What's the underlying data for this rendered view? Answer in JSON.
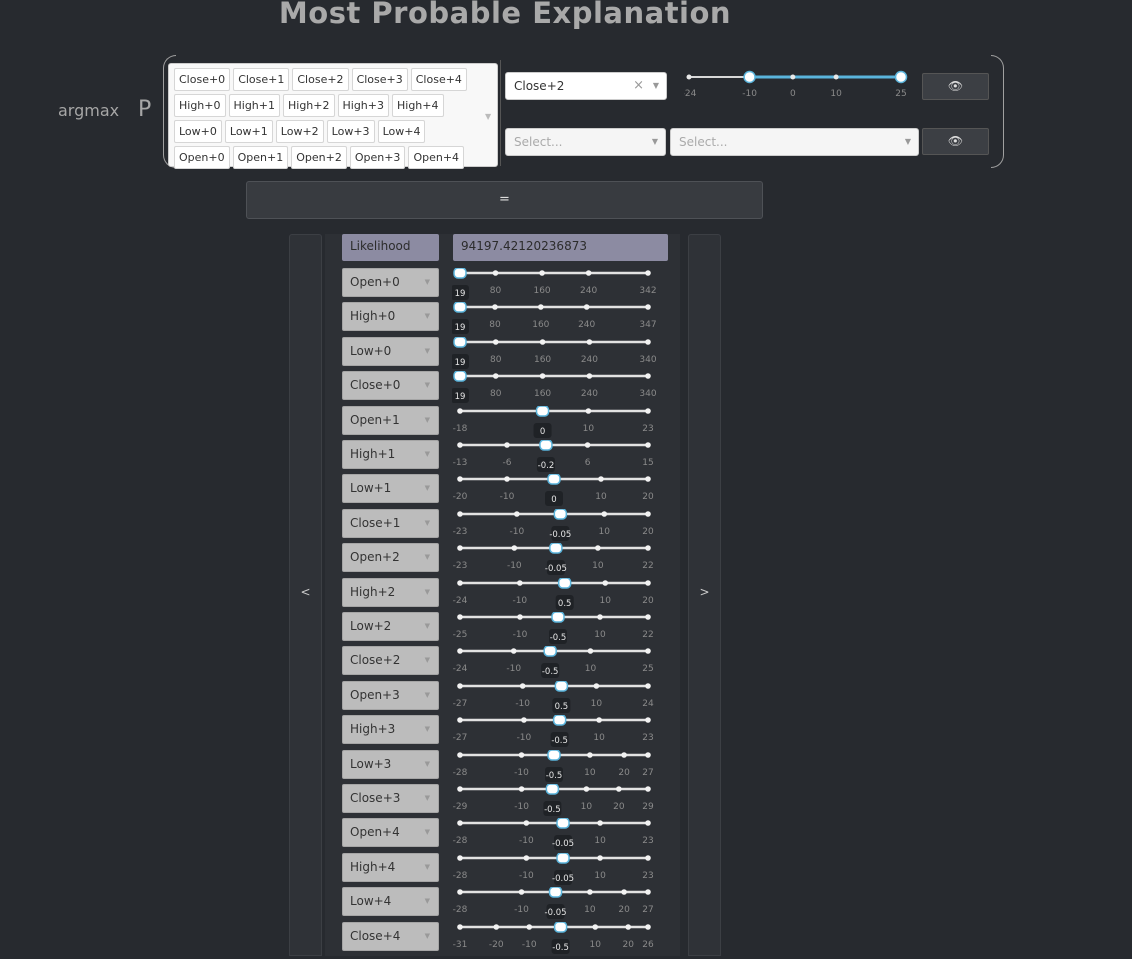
{
  "title": "Most Probable Explanation",
  "query": {
    "argmax_label": "argmax",
    "p_label": "P",
    "variables": [
      "Close+0",
      "Close+1",
      "Close+2",
      "Close+3",
      "Close+4",
      "High+0",
      "High+1",
      "High+2",
      "High+3",
      "High+4",
      "Low+0",
      "Low+1",
      "Low+2",
      "Low+3",
      "Low+4",
      "Open+0",
      "Open+1",
      "Open+2",
      "Open+3",
      "Open+4"
    ]
  },
  "target": {
    "selected": "Close+2",
    "clear_icon": "×",
    "range_ticks": [
      "-24",
      "-10",
      "0",
      "10",
      "25"
    ],
    "range_min": -24,
    "range_max": 25,
    "range_low": -10,
    "range_high": 25
  },
  "condition": {
    "placeholder1": "Select...",
    "placeholder2": "Select..."
  },
  "eye_icon": "👁",
  "equals_label": "=",
  "nav": {
    "prev": "<",
    "next": ">"
  },
  "likelihood": {
    "label": "Likelihood",
    "value": "94197.42120236873"
  },
  "rows": [
    {
      "name": "Open+0",
      "ticks": [
        "19",
        "80",
        "160",
        "240",
        "342"
      ],
      "min": 19,
      "max": 342,
      "value": 19,
      "value_label": "19"
    },
    {
      "name": "High+0",
      "ticks": [
        "19",
        "80",
        "160",
        "240",
        "347"
      ],
      "min": 19,
      "max": 347,
      "value": 19,
      "value_label": "19"
    },
    {
      "name": "Low+0",
      "ticks": [
        "19",
        "80",
        "160",
        "240",
        "340"
      ],
      "min": 19,
      "max": 340,
      "value": 19,
      "value_label": "19"
    },
    {
      "name": "Close+0",
      "ticks": [
        "19",
        "80",
        "160",
        "240",
        "340"
      ],
      "min": 19,
      "max": 340,
      "value": 19,
      "value_label": "19"
    },
    {
      "name": "Open+1",
      "ticks": [
        "-18",
        "0",
        "10",
        "23"
      ],
      "min": -18,
      "max": 23,
      "value": 0,
      "value_label": "0"
    },
    {
      "name": "High+1",
      "ticks": [
        "-13",
        "-6",
        "-0.2",
        "6",
        "15"
      ],
      "min": -13,
      "max": 15,
      "value": -0.2,
      "value_label": "-0.2"
    },
    {
      "name": "Low+1",
      "ticks": [
        "-20",
        "-10",
        "0",
        "10",
        "20"
      ],
      "min": -20,
      "max": 20,
      "value": 0,
      "value_label": "0"
    },
    {
      "name": "Close+1",
      "ticks": [
        "-23",
        "-10",
        "-0.05",
        "10",
        "20"
      ],
      "min": -23,
      "max": 20,
      "value": -0.05,
      "value_label": "-0.05"
    },
    {
      "name": "Open+2",
      "ticks": [
        "-23",
        "-10",
        "-0.05",
        "10",
        "22"
      ],
      "min": -23,
      "max": 22,
      "value": -0.05,
      "value_label": "-0.05"
    },
    {
      "name": "High+2",
      "ticks": [
        "-24",
        "-10",
        "0.5",
        "10",
        "20"
      ],
      "min": -24,
      "max": 20,
      "value": 0.5,
      "value_label": "0.5"
    },
    {
      "name": "Low+2",
      "ticks": [
        "-25",
        "-10",
        "-0.5",
        "10",
        "22"
      ],
      "min": -25,
      "max": 22,
      "value": -0.5,
      "value_label": "-0.5"
    },
    {
      "name": "Close+2",
      "ticks": [
        "-24",
        "-10",
        "-0.5",
        "10",
        "25"
      ],
      "min": -24,
      "max": 25,
      "value": -0.5,
      "value_label": "-0.5"
    },
    {
      "name": "Open+3",
      "ticks": [
        "-27",
        "-10",
        "0.5",
        "10",
        "24"
      ],
      "min": -27,
      "max": 24,
      "value": 0.5,
      "value_label": "0.5"
    },
    {
      "name": "High+3",
      "ticks": [
        "-27",
        "-10",
        "-0.5",
        "10",
        "23"
      ],
      "min": -27,
      "max": 23,
      "value": -0.5,
      "value_label": "-0.5"
    },
    {
      "name": "Low+3",
      "ticks": [
        "-28",
        "-10",
        "-0.5",
        "10",
        "20",
        "27"
      ],
      "min": -28,
      "max": 27,
      "value": -0.5,
      "value_label": "-0.5"
    },
    {
      "name": "Close+3",
      "ticks": [
        "-29",
        "-10",
        "-0.5",
        "10",
        "20",
        "29"
      ],
      "min": -29,
      "max": 29,
      "value": -0.5,
      "value_label": "-0.5"
    },
    {
      "name": "Open+4",
      "ticks": [
        "-28",
        "-10",
        "-0.05",
        "10",
        "23"
      ],
      "min": -28,
      "max": 23,
      "value": -0.05,
      "value_label": "-0.05"
    },
    {
      "name": "High+4",
      "ticks": [
        "-28",
        "-10",
        "-0.05",
        "10",
        "23"
      ],
      "min": -28,
      "max": 23,
      "value": -0.05,
      "value_label": "-0.05"
    },
    {
      "name": "Low+4",
      "ticks": [
        "-28",
        "-10",
        "-0.05",
        "10",
        "20",
        "27"
      ],
      "min": -28,
      "max": 27,
      "value": -0.05,
      "value_label": "-0.05"
    },
    {
      "name": "Close+4",
      "ticks": [
        "-31",
        "-20",
        "-10",
        "-0.5",
        "10",
        "20",
        "26"
      ],
      "min": -31,
      "max": 26,
      "value": -0.5,
      "value_label": "-0.5"
    }
  ],
  "colors": {
    "accent": "#5ab4dc",
    "likelihood_bg": "#8c8ba2",
    "background": "#272a2f"
  }
}
